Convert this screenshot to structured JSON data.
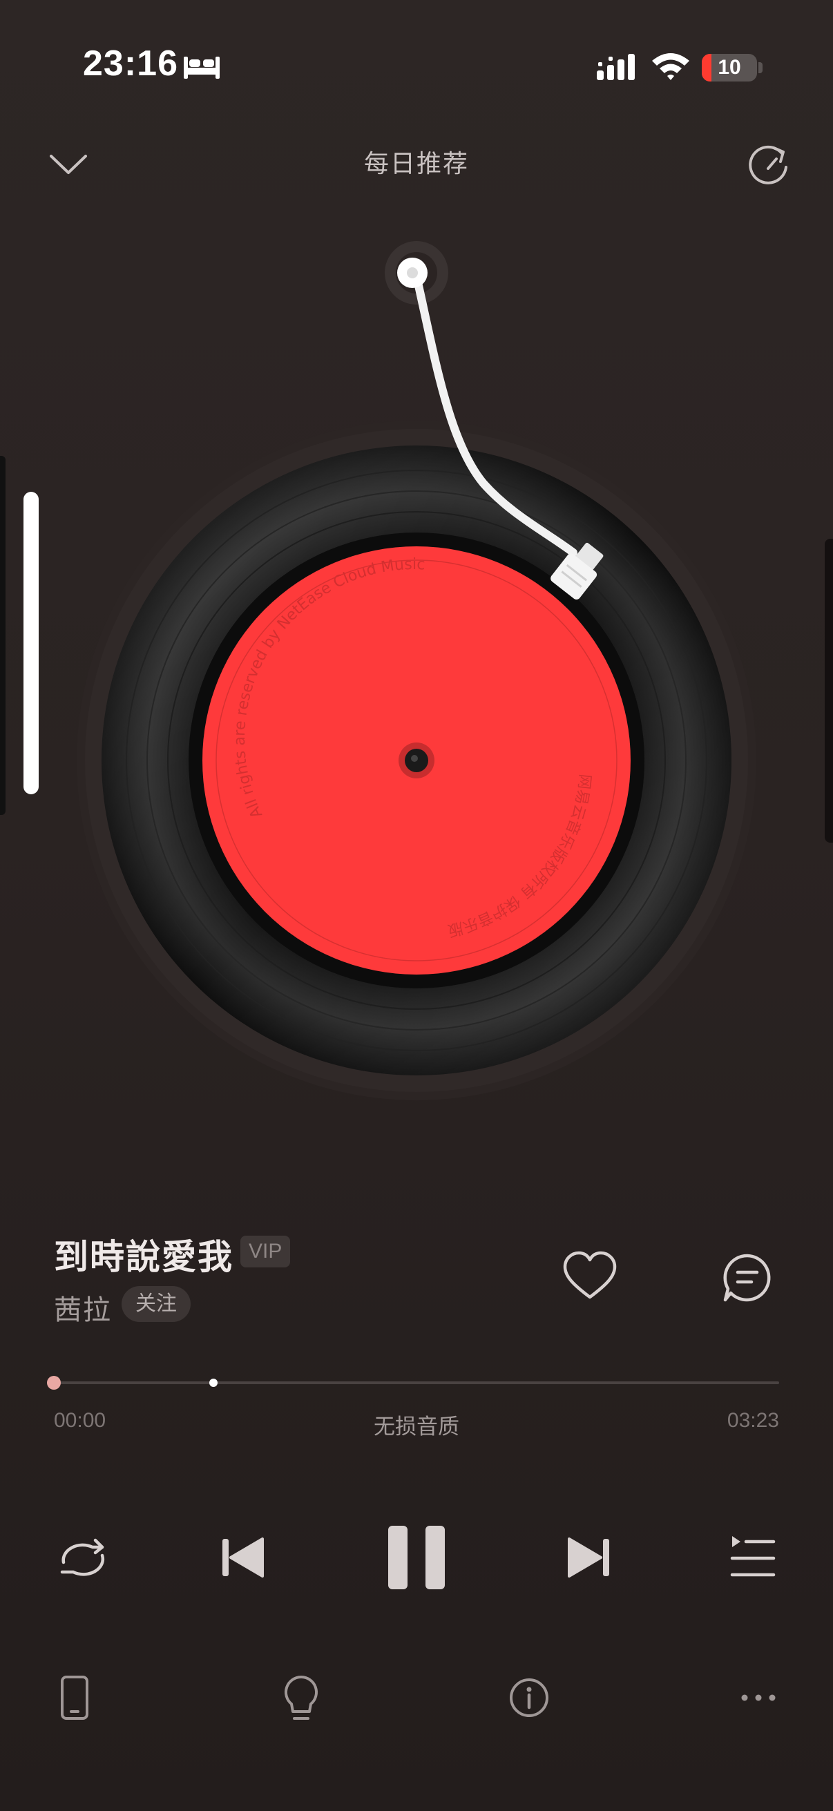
{
  "status_bar": {
    "time": "23:16",
    "battery_level": "10",
    "icons": [
      "sleep-focus-icon",
      "cellular-signal-icon",
      "wifi-icon",
      "battery-icon"
    ]
  },
  "header": {
    "title": "每日推荐",
    "icons": [
      "chevron-down-icon",
      "refresh-icon"
    ]
  },
  "record": {
    "label_text_top": "All rights are reserved by NetEase Cloud Music",
    "label_text_bottom": "网易云音乐版权所有 保护音乐版权"
  },
  "song": {
    "title": "到時說愛我",
    "badge": "VIP",
    "artist": "茜拉",
    "follow_label": "关注"
  },
  "progress": {
    "current_time": "00:00",
    "total_time": "03:23",
    "quality": "无损音质",
    "played_fraction": 0.0,
    "buffered_fraction": 0.22
  },
  "controls": {
    "icons": [
      "repeat-icon",
      "previous-icon",
      "pause-icon",
      "next-icon",
      "playlist-icon"
    ]
  },
  "toolbar": {
    "icons": [
      "phone-device-icon",
      "lightbulb-icon",
      "info-icon",
      "more-icon"
    ]
  },
  "colors": {
    "background": "#2a2322",
    "label_red": "#fe3a3b",
    "accent_progress": "#e9a8a3"
  }
}
